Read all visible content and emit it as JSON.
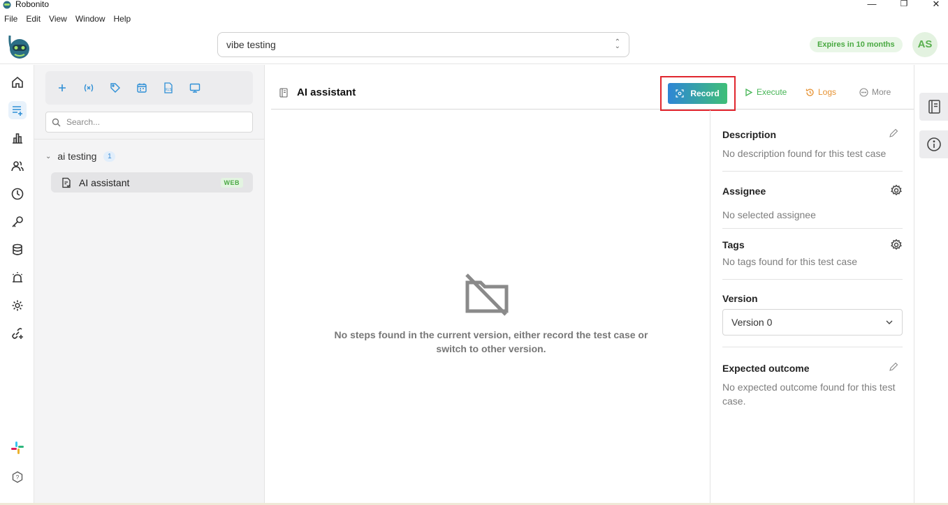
{
  "window": {
    "title": "Robonito",
    "minimize": "—",
    "maximize": "❐",
    "close": "✕"
  },
  "menu": [
    "File",
    "Edit",
    "View",
    "Window",
    "Help"
  ],
  "header": {
    "project_value": "vibe testing",
    "expires_label": "Expires in 10 months",
    "avatar_initials": "AS"
  },
  "nav": {
    "items": [
      "home-icon",
      "test-cases-icon",
      "reports-icon",
      "users-icon",
      "schedule-icon",
      "keys-icon",
      "database-icon",
      "alerts-icon",
      "settings-icon",
      "integrations-icon",
      "slack-icon",
      "help-icon"
    ],
    "accent_color": "#2e8fd6"
  },
  "sidebar": {
    "search_placeholder": "Search...",
    "folder": {
      "name": "ai testing",
      "count": "1"
    },
    "test_case": {
      "name": "AI assistant",
      "badge": "WEB"
    }
  },
  "main": {
    "title": "AI assistant",
    "record_label": "Record",
    "execute_label": "Execute",
    "logs_label": "Logs",
    "more_label": "More",
    "empty_text": "No steps found in the current version, either record the test case or switch to other version."
  },
  "details": {
    "description_title": "Description",
    "description_text": "No description found for this test case",
    "assignee_title": "Assignee",
    "assignee_text": "No selected assignee",
    "tags_title": "Tags",
    "tags_text": "No tags found for this test case",
    "version_title": "Version",
    "version_value": "Version 0",
    "outcome_title": "Expected outcome",
    "outcome_text": "No expected outcome found for this test case."
  }
}
